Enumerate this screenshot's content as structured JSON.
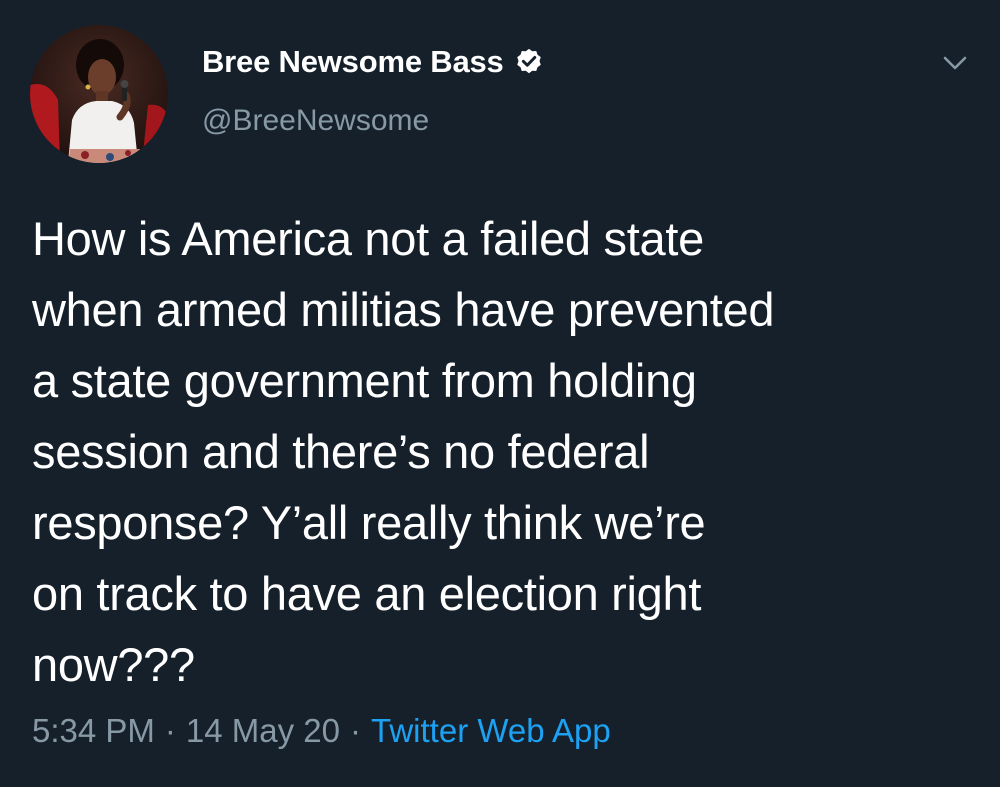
{
  "author": {
    "display_name": "Bree Newsome Bass",
    "handle": "@BreeNewsome",
    "verified": true,
    "verified_icon": "verified-badge-icon"
  },
  "tweet": {
    "text": "How is America not a failed state\nwhen armed militias have prevented\na state government from holding\nsession and there’s no federal\nresponse? Y’all really think we’re\non track to have an election right\nnow???",
    "time": "5:34 PM",
    "date": "14 May 20",
    "source": "Twitter Web App",
    "separator": "·"
  },
  "controls": {
    "more_icon": "chevron-down-icon"
  },
  "colors": {
    "background": "#15202b",
    "primary_text": "#ffffff",
    "secondary_text": "#8899a6",
    "accent": "#1da1f2"
  }
}
